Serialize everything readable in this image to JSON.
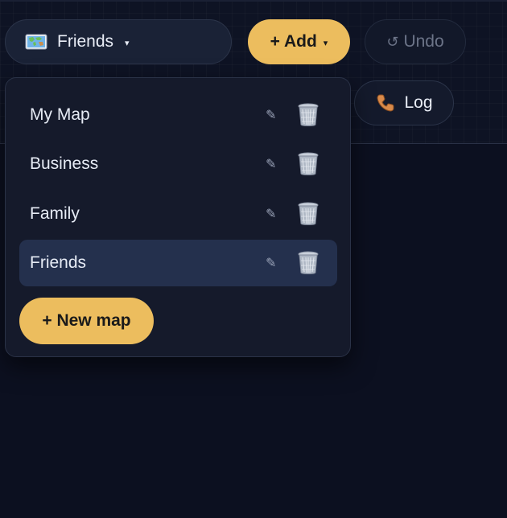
{
  "toolbar": {
    "map_selector": {
      "label": "Friends",
      "icon": "world-map-icon",
      "caret": "▾"
    },
    "add_button": {
      "label": "+ Add",
      "caret": "▾"
    },
    "undo_button": {
      "label": "Undo",
      "icon": "↺"
    },
    "log_button": {
      "label": "Log",
      "icon": "phone-icon"
    }
  },
  "dropdown": {
    "maps": [
      {
        "label": "My Map",
        "selected": false
      },
      {
        "label": "Business",
        "selected": false
      },
      {
        "label": "Family",
        "selected": false
      },
      {
        "label": "Friends",
        "selected": true
      }
    ],
    "edit_icon": "✎",
    "new_map_label": "+ New map"
  },
  "colors": {
    "accent": "#ecbd5e",
    "background": "#0c1020",
    "panel": "#151a2b",
    "selected_row": "#24304d"
  }
}
